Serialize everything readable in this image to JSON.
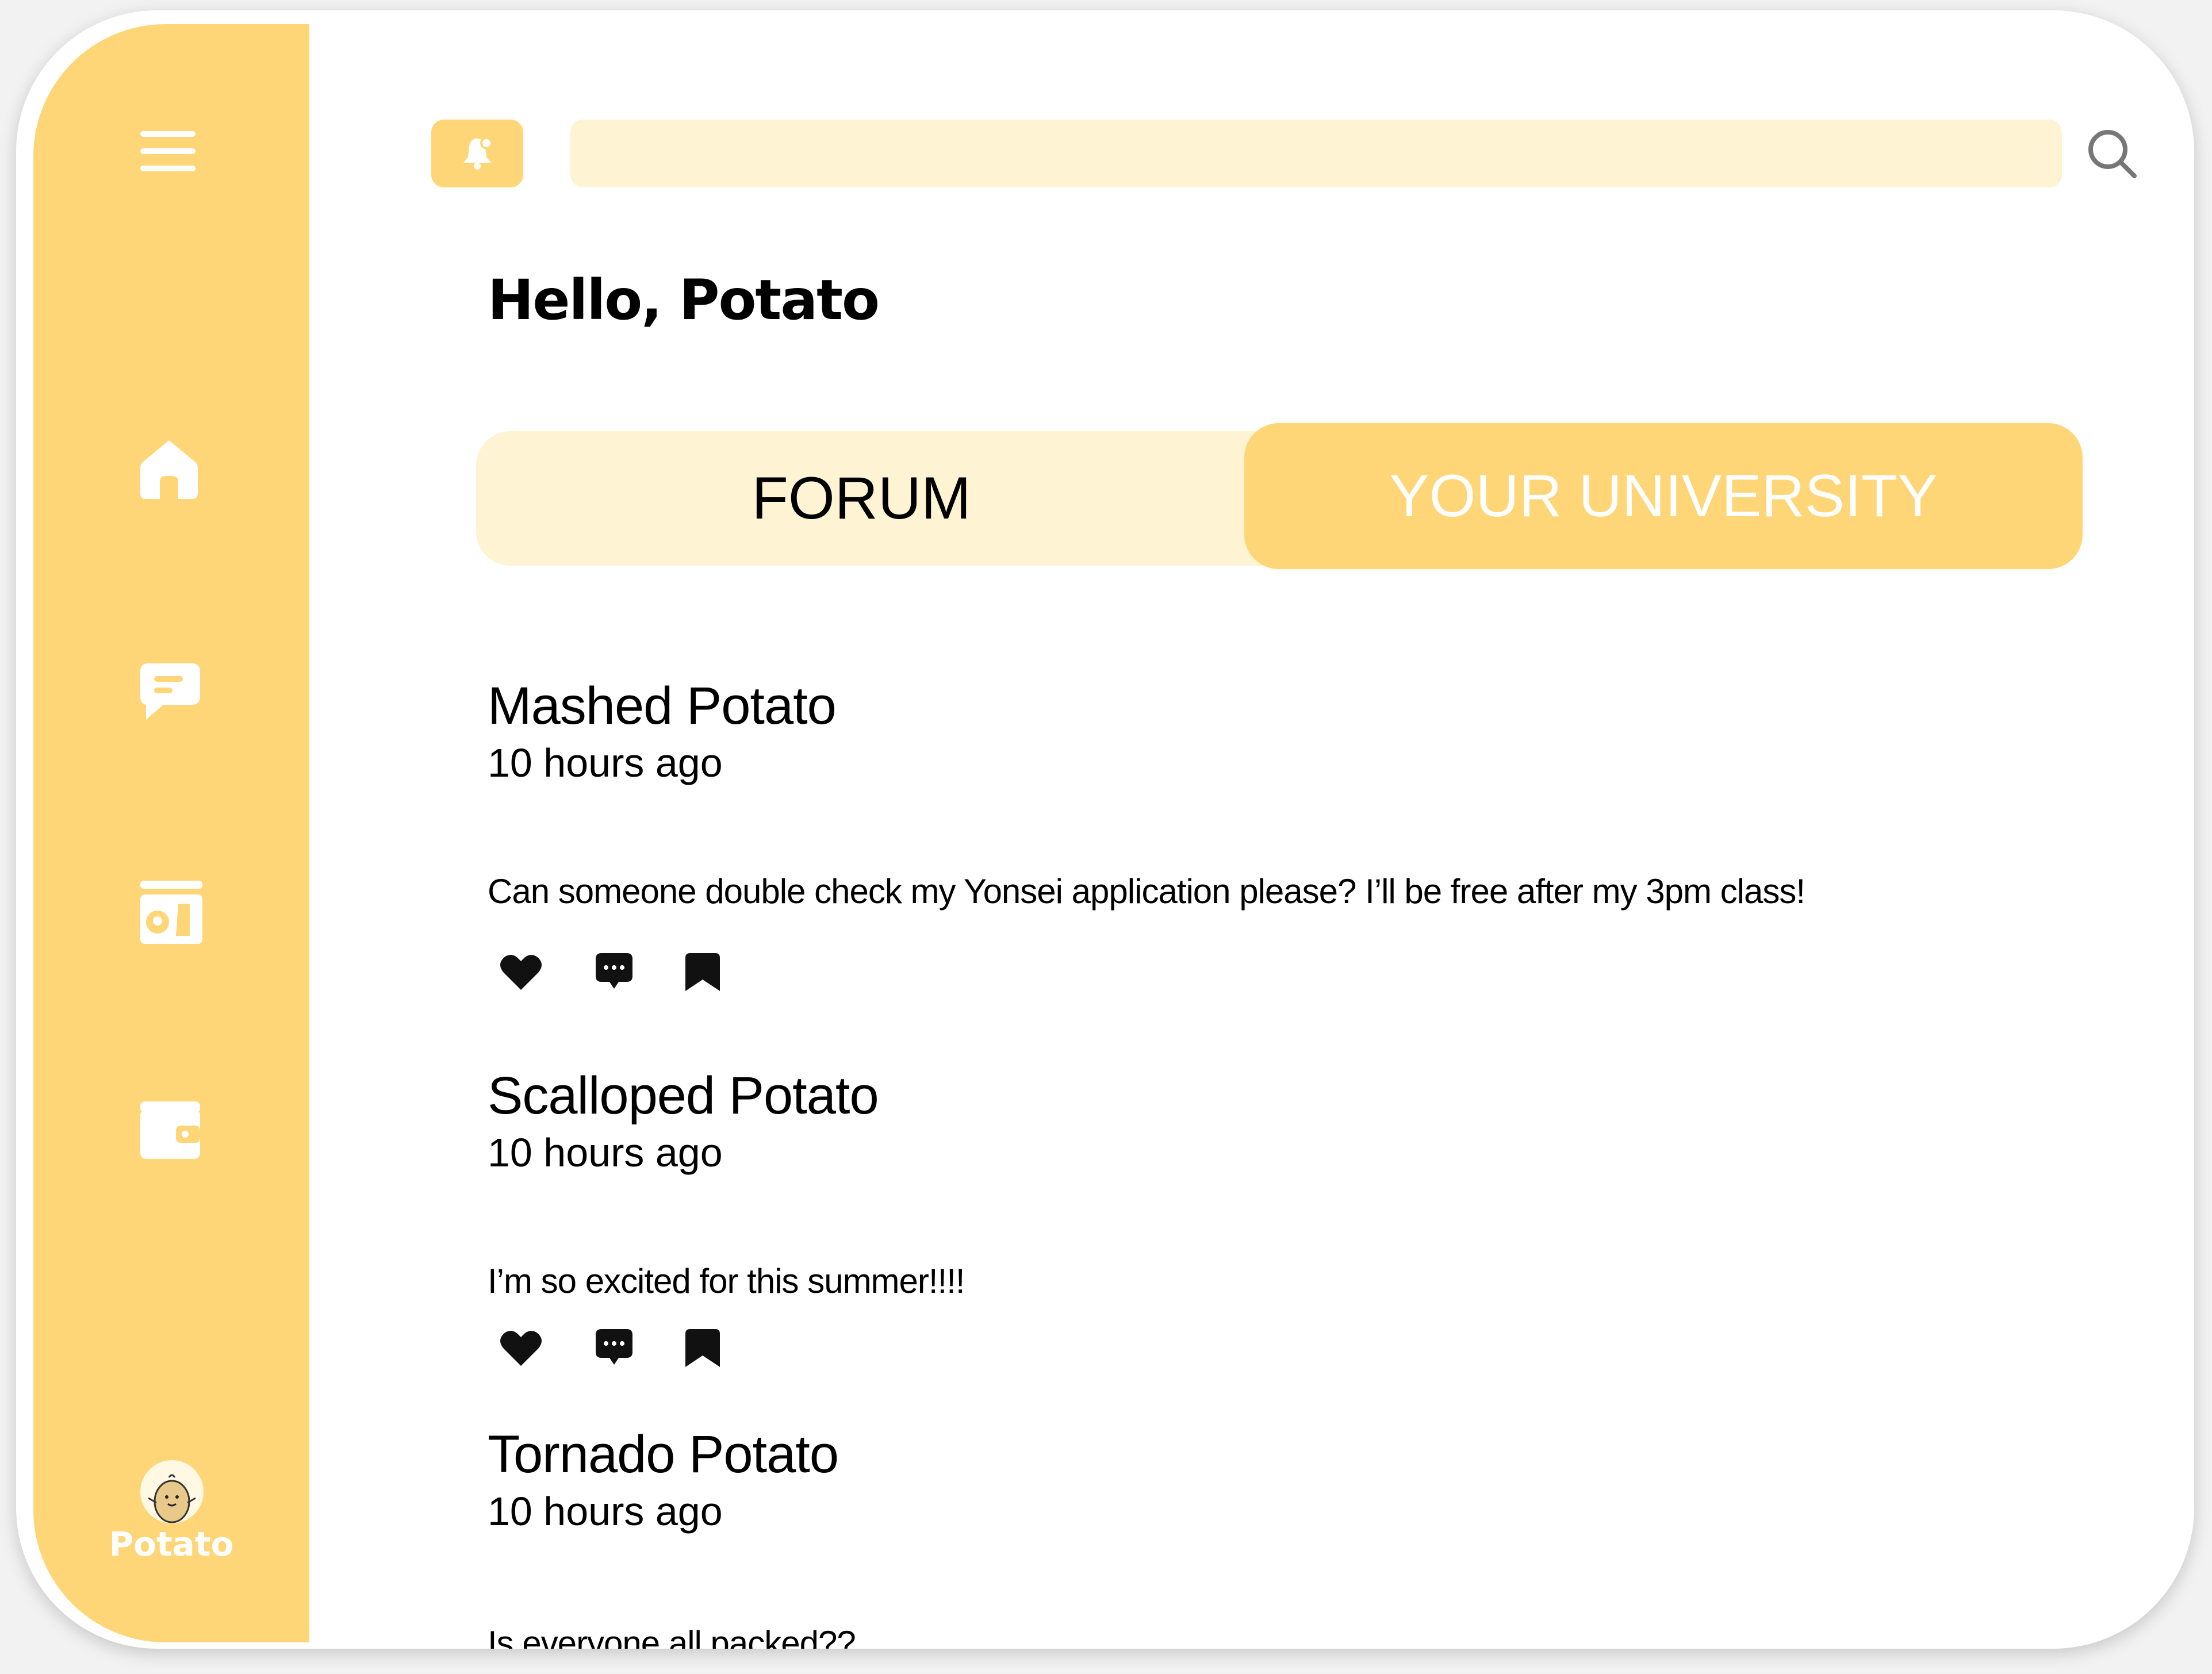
{
  "user": {
    "greeting": "Hello, Potato",
    "name": "Potato"
  },
  "search": {
    "placeholder": ""
  },
  "tabs": [
    {
      "label": "FORUM",
      "active": false
    },
    {
      "label": "YOUR UNIVERSITY",
      "active": true
    }
  ],
  "sidebar": {
    "items": [
      {
        "icon": "menu-icon"
      },
      {
        "icon": "home-icon"
      },
      {
        "icon": "chat-icon"
      },
      {
        "icon": "map-icon"
      },
      {
        "icon": "wallet-icon"
      }
    ]
  },
  "posts": [
    {
      "author": "Mashed Potato",
      "time": "10 hours ago",
      "body": "Can someone double check my Yonsei application please? I’ll be free after my  3pm class!"
    },
    {
      "author": "Scalloped Potato",
      "time": "10 hours ago",
      "body": "I’m so excited for this summer!!!!"
    },
    {
      "author": "Tornado Potato",
      "time": "10 hours ago",
      "body": "Is everyone all packed??"
    }
  ],
  "colors": {
    "accent": "#ffd677",
    "accent_light": "#fef3d2",
    "text": "#000000",
    "background": "#ffffff"
  }
}
